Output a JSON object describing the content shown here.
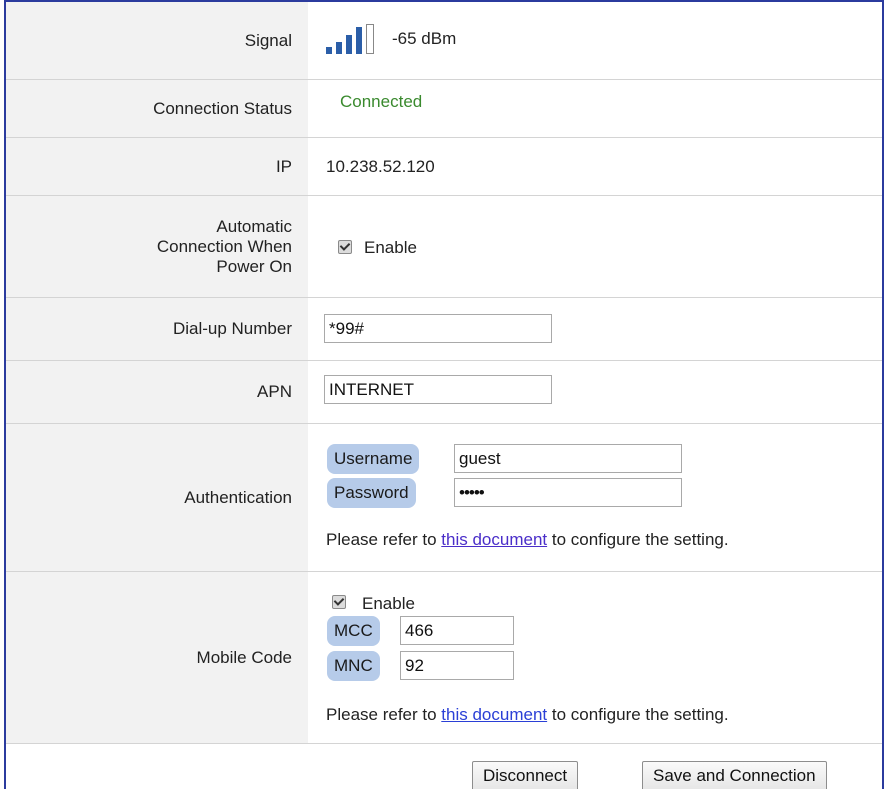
{
  "signal": {
    "label": "Signal",
    "value": "-65 dBm",
    "bars_filled": 4,
    "bars_total": 5,
    "bar_color": "#2b5ea8"
  },
  "connection_status": {
    "label": "Connection Status",
    "value": "Connected",
    "color": "#3a8a2e"
  },
  "ip": {
    "label": "IP",
    "value": "10.238.52.120"
  },
  "auto_connect": {
    "label_line1": "Automatic",
    "label_line2": "Connection When",
    "label_line3": "Power On",
    "checkbox_label": "Enable",
    "checked": true
  },
  "dialup": {
    "label": "Dial-up Number",
    "value": "*99#"
  },
  "apn": {
    "label": "APN",
    "value": "INTERNET"
  },
  "authentication": {
    "label": "Authentication",
    "username_tag": "Username",
    "username_value": "guest",
    "password_tag": "Password",
    "password_value": "•••••",
    "note_prefix": "Please refer to ",
    "note_link": "this document",
    "note_suffix": " to configure the setting."
  },
  "mobile_code": {
    "label": "Mobile Code",
    "checkbox_label": "Enable",
    "checked": true,
    "mcc_tag": "MCC",
    "mcc_value": "466",
    "mnc_tag": "MNC",
    "mnc_value": "92",
    "note_prefix": "Please refer to ",
    "note_link": "this document",
    "note_suffix": " to configure the setting."
  },
  "buttons": {
    "disconnect": "Disconnect",
    "save_connect": "Save and Connection"
  }
}
